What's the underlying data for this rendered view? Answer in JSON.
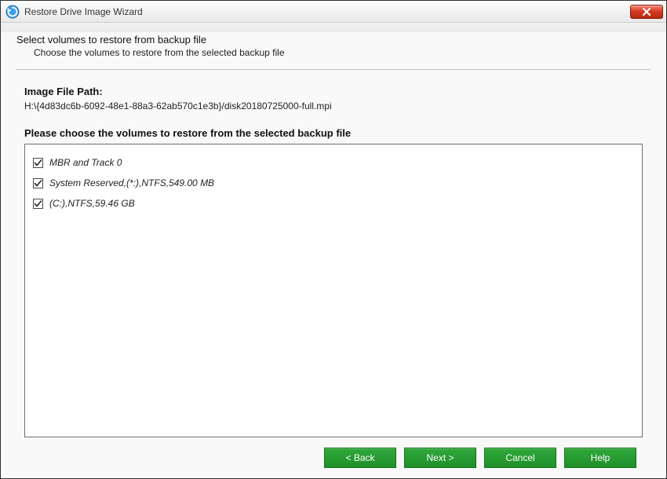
{
  "window": {
    "title": "Restore Drive Image Wizard"
  },
  "header": {
    "heading": "Select volumes to restore from backup file",
    "subheading": "Choose the volumes to restore from the selected backup file"
  },
  "imagefile": {
    "label": "Image File Path:",
    "path": "H:\\{4d83dc6b-6092-48e1-88a3-62ab570c1e3b}/disk20180725000-full.mpi"
  },
  "volumes": {
    "prompt": "Please choose the volumes to restore from the selected backup file",
    "items": [
      {
        "label": "MBR and Track 0",
        "checked": true
      },
      {
        "label": "System Reserved,(*:),NTFS,549.00 MB",
        "checked": true
      },
      {
        "label": "(C:),NTFS,59.46 GB",
        "checked": true
      }
    ]
  },
  "footer": {
    "back": "< Back",
    "next": "Next >",
    "cancel": "Cancel",
    "help": "Help"
  },
  "icons": {
    "app": "refresh-circle-icon",
    "close": "close-icon",
    "check": "check-icon"
  }
}
